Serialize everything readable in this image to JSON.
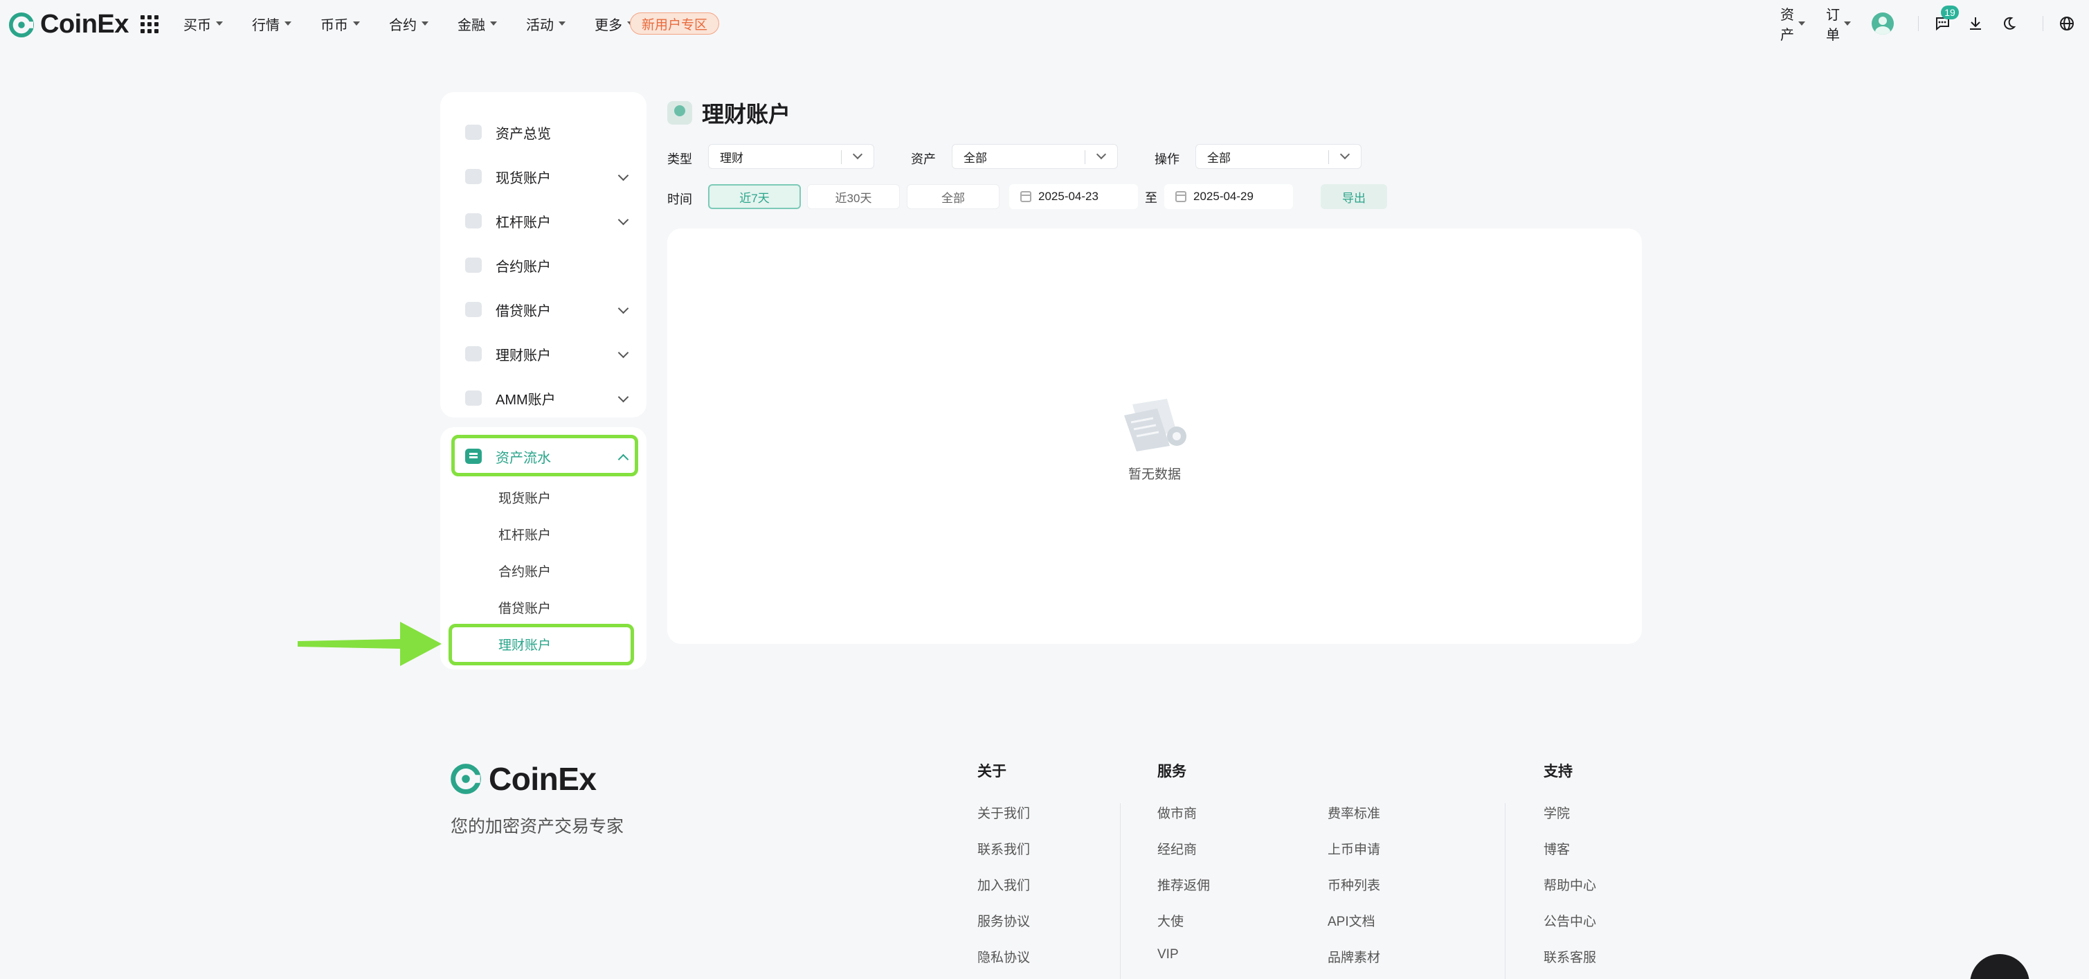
{
  "brand": {
    "name": "CoinEx",
    "accent": "#2aa58a",
    "highlight": "#84e03e"
  },
  "topnav": {
    "menu": [
      {
        "label": "买币"
      },
      {
        "label": "行情"
      },
      {
        "label": "币币"
      },
      {
        "label": "合约"
      },
      {
        "label": "金融"
      },
      {
        "label": "活动"
      },
      {
        "label": "更多"
      }
    ],
    "promo_label": "新用户专区",
    "assets_label": "资产",
    "orders_label": "订单",
    "notification_count": "19"
  },
  "sidebar": {
    "accounts": [
      {
        "label": "资产总览",
        "expandable": false
      },
      {
        "label": "现货账户",
        "expandable": true
      },
      {
        "label": "杠杆账户",
        "expandable": true
      },
      {
        "label": "合约账户",
        "expandable": false
      },
      {
        "label": "借贷账户",
        "expandable": true
      },
      {
        "label": "理财账户",
        "expandable": true
      },
      {
        "label": "AMM账户",
        "expandable": true
      }
    ],
    "flow": {
      "label": "资产流水",
      "sub_items": [
        {
          "label": "现货账户"
        },
        {
          "label": "杠杆账户"
        },
        {
          "label": "合约账户"
        },
        {
          "label": "借贷账户"
        },
        {
          "label": "理财账户"
        }
      ]
    }
  },
  "main": {
    "title": "理财账户",
    "filters": {
      "type_label": "类型",
      "type_value": "理财",
      "asset_label": "资产",
      "asset_value": "全部",
      "op_label": "操作",
      "op_value": "全部",
      "time_label": "时间",
      "ranges": [
        {
          "label": "近7天"
        },
        {
          "label": "近30天"
        },
        {
          "label": "全部"
        }
      ],
      "start_date": "2025-04-23",
      "to_label": "至",
      "end_date": "2025-04-29",
      "export_label": "导出"
    },
    "empty_text": "暂无数据"
  },
  "footer": {
    "brand": "CoinEx",
    "slogan": "您的加密资产交易专家",
    "about": {
      "title": "关于",
      "links": [
        "关于我们",
        "联系我们",
        "加入我们",
        "服务协议",
        "隐私协议"
      ]
    },
    "services": {
      "title": "服务",
      "col1": [
        "做市商",
        "经纪商",
        "推荐返佣",
        "大使",
        "VIP"
      ],
      "col2": [
        "费率标准",
        "上币申请",
        "币种列表",
        "API文档",
        "品牌素材"
      ]
    },
    "support": {
      "title": "支持",
      "links": [
        "学院",
        "博客",
        "帮助中心",
        "公告中心",
        "联系客服"
      ]
    }
  }
}
